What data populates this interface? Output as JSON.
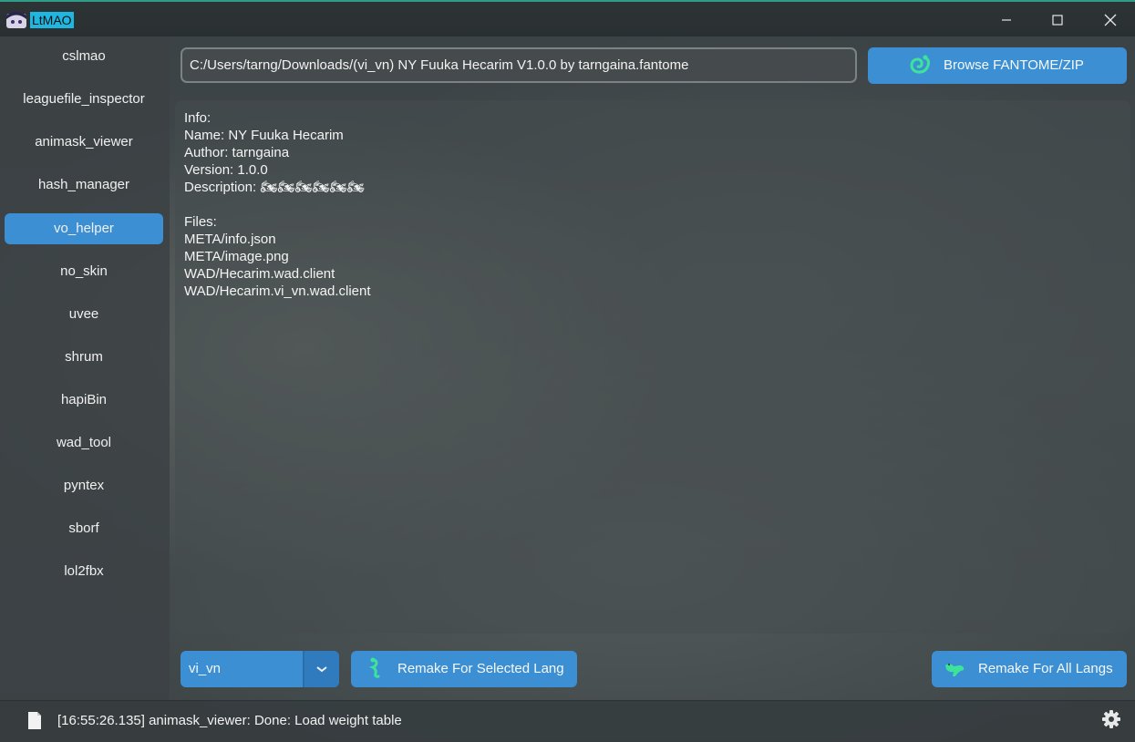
{
  "window": {
    "title": "LtMAO",
    "controls": [
      "minimize-icon",
      "maximize-icon",
      "close-icon"
    ]
  },
  "sidebar": {
    "items": [
      {
        "label": "cslmao"
      },
      {
        "label": "leaguefile_inspector"
      },
      {
        "label": "animask_viewer"
      },
      {
        "label": "hash_manager"
      },
      {
        "label": "vo_helper",
        "active": true
      },
      {
        "label": "no_skin"
      },
      {
        "label": "uvee"
      },
      {
        "label": "shrum"
      },
      {
        "label": "hapiBin"
      },
      {
        "label": "wad_tool"
      },
      {
        "label": "pyntex"
      },
      {
        "label": "sborf"
      },
      {
        "label": "lol2fbx"
      }
    ]
  },
  "main": {
    "path_value": "C:/Users/tarng/Downloads/(vi_vn) NY Fuuka Hecarim V1.0.0 by tarngaina.fantome",
    "browse_label": "Browse FANTOME/ZIP",
    "info_lines": [
      "Info:",
      "Name: NY Fuuka Hecarim",
      "Author: tarngaina",
      "Version: 1.0.0",
      "Description: 🏍🏍🏍🏍🏍🏍",
      "",
      "Files:",
      "META/info.json",
      "META/image.png",
      "WAD/Hecarim.wad.client",
      "WAD/Hecarim.vi_vn.wad.client"
    ],
    "lang_selected": "vi_vn",
    "remake_selected_label": "Remake For Selected Lang",
    "remake_all_label": "Remake For All Langs"
  },
  "status": {
    "message": "[16:55:26.135] animask_viewer: Done: Load weight table"
  },
  "colors": {
    "accent": "#3c8fd2",
    "title_highlight": "#1fb6e0",
    "icon_green": "#3ee39a"
  }
}
